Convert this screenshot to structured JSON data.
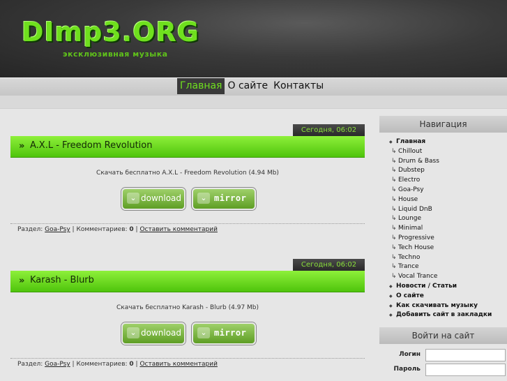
{
  "site": {
    "logo": "DImp3.ORG",
    "slogan": "эксклюзивная музыка"
  },
  "nav": {
    "items": [
      "Главная",
      "О сайте",
      "Контакты"
    ],
    "active": 0
  },
  "posts": [
    {
      "date": "Сегодня, 06:02",
      "title": "A.X.L - Freedom Revolution",
      "desc": "Скачать бесплатно A.X.L - Freedom Revolution (4.94 Mb)",
      "download_label": "download",
      "mirror_label": "mirror",
      "meta": {
        "section_label": "Раздел:",
        "section": "Goa-Psy",
        "comments_label": "Комментариев:",
        "comments": "0",
        "leave_comment": "Оставить комментарий"
      }
    },
    {
      "date": "Сегодня, 06:02",
      "title": "Karash - Blurb",
      "desc": "Скачать бесплатно Karash - Blurb (4.97 Mb)",
      "download_label": "download",
      "mirror_label": "mirror",
      "meta": {
        "section_label": "Раздел:",
        "section": "Goa-Psy",
        "comments_label": "Комментариев:",
        "comments": "0",
        "leave_comment": "Оставить комментарий"
      }
    }
  ],
  "sidebar": {
    "nav_title": "Навигация",
    "items": [
      {
        "label": "Главная",
        "top": true
      },
      {
        "label": "Chillout"
      },
      {
        "label": "Drum & Bass"
      },
      {
        "label": "Dubstep"
      },
      {
        "label": "Electro"
      },
      {
        "label": "Goa-Psy"
      },
      {
        "label": "House"
      },
      {
        "label": "Liquid DnB"
      },
      {
        "label": "Lounge"
      },
      {
        "label": "Minimal"
      },
      {
        "label": "Progressive"
      },
      {
        "label": "Tech House"
      },
      {
        "label": "Techno"
      },
      {
        "label": "Trance"
      },
      {
        "label": "Vocal Trance"
      },
      {
        "label": "Новости / Статьи",
        "top": true
      },
      {
        "label": "О сайте",
        "top": true
      },
      {
        "label": "Как скачивать музыку",
        "top": true
      },
      {
        "label": "Добавить сайт в закладки",
        "top": true
      }
    ],
    "login_title": "Войти на сайт",
    "login_label": "Логин",
    "password_label": "Пароль",
    "login_value": "",
    "password_value": ""
  },
  "colors": {
    "accent": "#6fe01e",
    "title_bar": "#5fd014"
  }
}
